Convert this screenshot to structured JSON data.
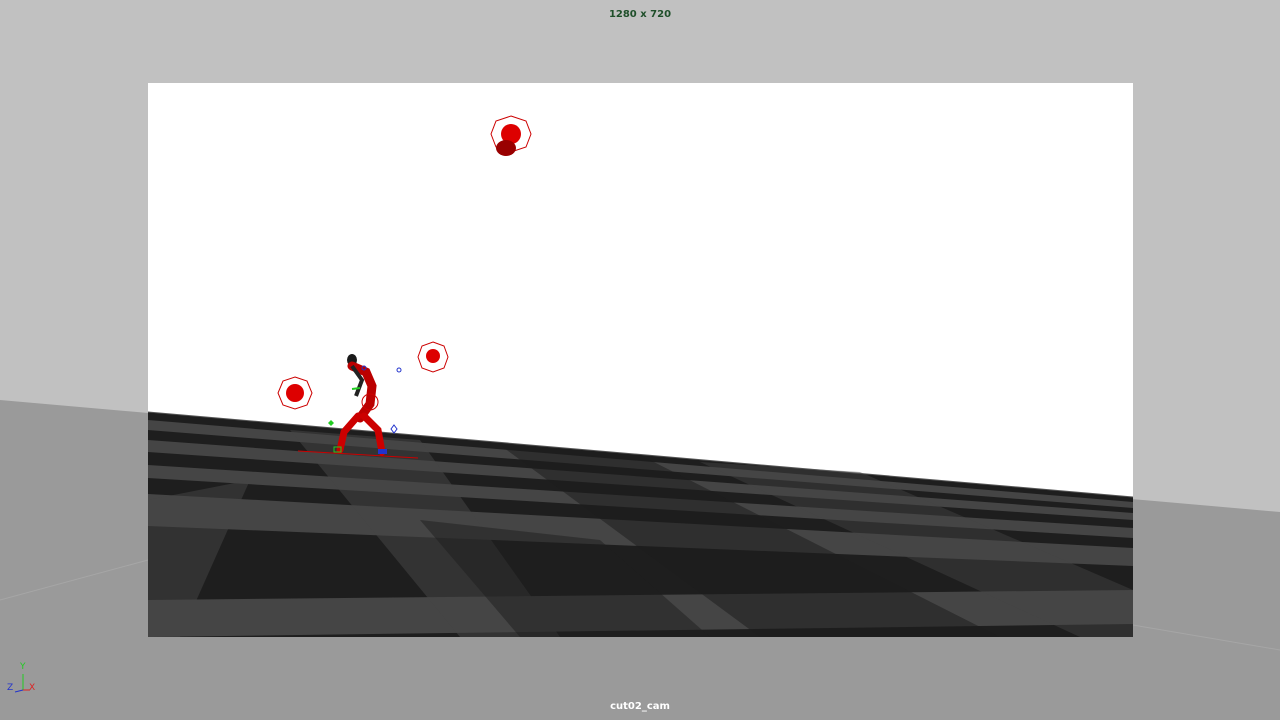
{
  "hud": {
    "resolution_label": "1280 x 720",
    "camera_label": "cut02_cam"
  },
  "axis_gizmo": {
    "y_label": "Y",
    "z_label": "Z",
    "x_label": "X",
    "y_color": "#22cc22",
    "z_color": "#2233cc",
    "x_color": "#dd2222"
  },
  "viewport": {
    "background_color": "#c1c1c1",
    "gate_background_color": "#ffffff",
    "ground_dark_color": "#1e1e1e",
    "ground_light_color": "#454545",
    "outside_ground_color": "#9a9a9a",
    "control_color": "#cc0000"
  },
  "scene": {
    "character": "character-rig",
    "controls": [
      "ball-control",
      "ball-control",
      "ball-control",
      "ball-control"
    ]
  }
}
